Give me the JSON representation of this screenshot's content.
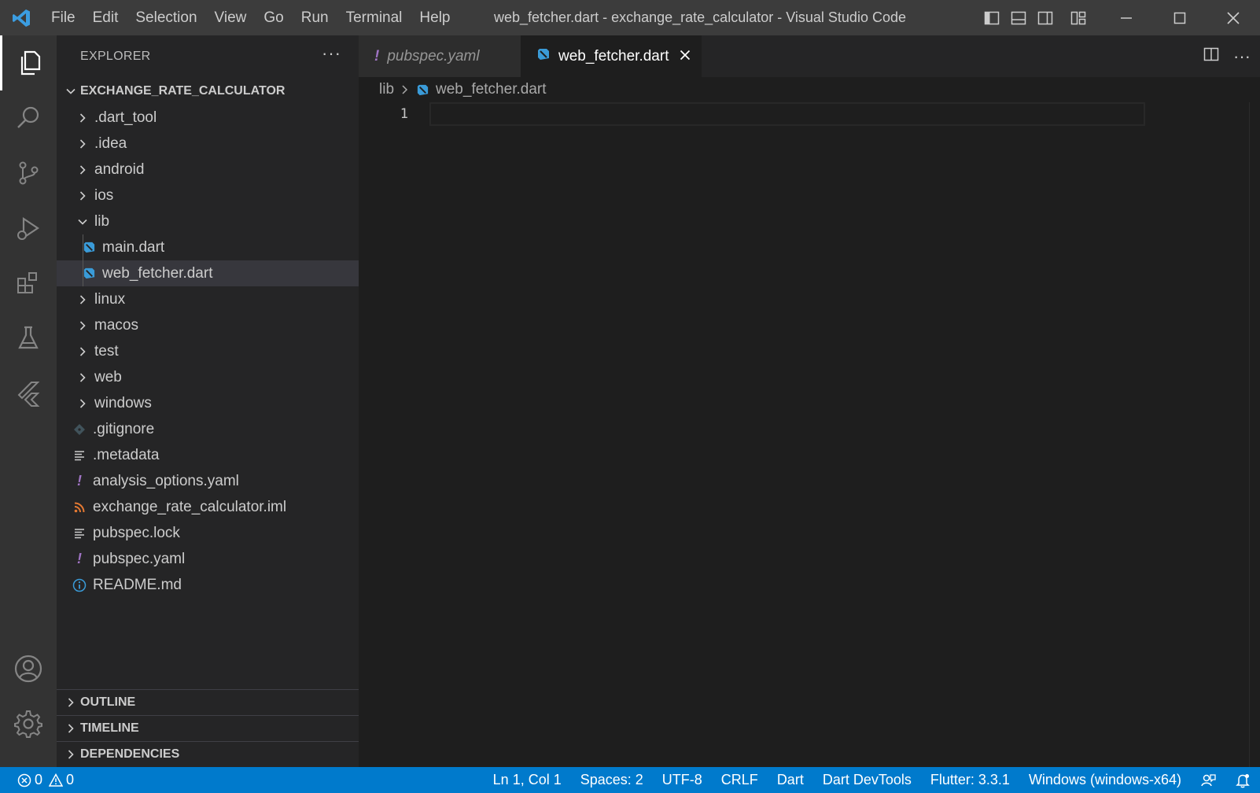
{
  "titlebar": {
    "menu": [
      "File",
      "Edit",
      "Selection",
      "View",
      "Go",
      "Run",
      "Terminal",
      "Help"
    ],
    "window_title": "web_fetcher.dart - exchange_rate_calculator - Visual Studio Code"
  },
  "activitybar": {
    "items": [
      "explorer-icon",
      "search-icon",
      "source-control-icon",
      "run-debug-icon",
      "extensions-icon",
      "testing-icon",
      "flutter-icon"
    ],
    "bottom": [
      "account-icon",
      "manage-gear-icon"
    ]
  },
  "sidebar": {
    "title": "EXPLORER",
    "more": "···",
    "project": "EXCHANGE_RATE_CALCULATOR",
    "tree": [
      {
        "label": ".dart_tool",
        "type": "folder"
      },
      {
        "label": ".idea",
        "type": "folder"
      },
      {
        "label": "android",
        "type": "folder"
      },
      {
        "label": "ios",
        "type": "folder"
      },
      {
        "label": "lib",
        "type": "folder-open"
      },
      {
        "label": "main.dart",
        "type": "dart"
      },
      {
        "label": "web_fetcher.dart",
        "type": "dart",
        "selected": true
      },
      {
        "label": "linux",
        "type": "folder"
      },
      {
        "label": "macos",
        "type": "folder"
      },
      {
        "label": "test",
        "type": "folder"
      },
      {
        "label": "web",
        "type": "folder"
      },
      {
        "label": "windows",
        "type": "folder"
      },
      {
        "label": ".gitignore",
        "type": "git"
      },
      {
        "label": ".metadata",
        "type": "text"
      },
      {
        "label": "analysis_options.yaml",
        "type": "yaml"
      },
      {
        "label": "exchange_rate_calculator.iml",
        "type": "rss"
      },
      {
        "label": "pubspec.lock",
        "type": "text"
      },
      {
        "label": "pubspec.yaml",
        "type": "yaml"
      },
      {
        "label": "README.md",
        "type": "info"
      }
    ],
    "sections": [
      "OUTLINE",
      "TIMELINE",
      "DEPENDENCIES"
    ]
  },
  "editor": {
    "tabs": [
      {
        "label": "pubspec.yaml",
        "active": false
      },
      {
        "label": "web_fetcher.dart",
        "active": true
      }
    ],
    "breadcrumb": {
      "folder": "lib",
      "file": "web_fetcher.dart"
    },
    "line_number": "1"
  },
  "statusbar": {
    "errors": "0",
    "warnings": "0",
    "items": [
      "Ln 1, Col 1",
      "Spaces: 2",
      "UTF-8",
      "CRLF",
      "Dart",
      "Dart DevTools",
      "Flutter: 3.3.1",
      "Windows (windows-x64)"
    ]
  },
  "colors": {
    "accent": "#007acc",
    "dart": "#3a9bd8",
    "yaml": "#a074c4",
    "rss": "#e37933"
  }
}
